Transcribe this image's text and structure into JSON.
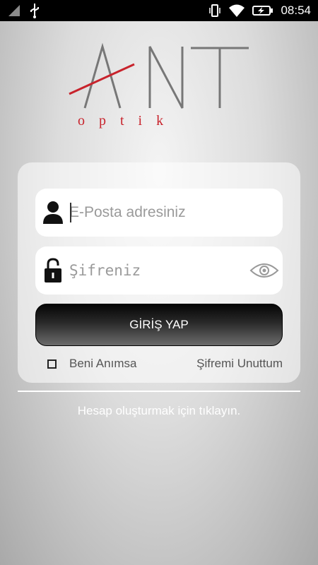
{
  "status_bar": {
    "time": "08:54",
    "icons": [
      "signal-icon",
      "usb-icon",
      "vibrate-icon",
      "wifi-icon",
      "battery-charging-icon"
    ]
  },
  "logo": {
    "main": "ANT",
    "sub": "optik",
    "colors": {
      "letters": "#777777",
      "accent": "#c8232c"
    }
  },
  "form": {
    "email_placeholder": "E-Posta adresiniz",
    "email_value": "",
    "password_placeholder": "Şifreniz",
    "password_value": "",
    "login_label": "GİRİŞ YAP",
    "remember_label": "Beni Anımsa",
    "remember_checked": false,
    "forgot_label": "Şifremi Unuttum"
  },
  "signup_label": "Hesap oluşturmak için tıklayın."
}
